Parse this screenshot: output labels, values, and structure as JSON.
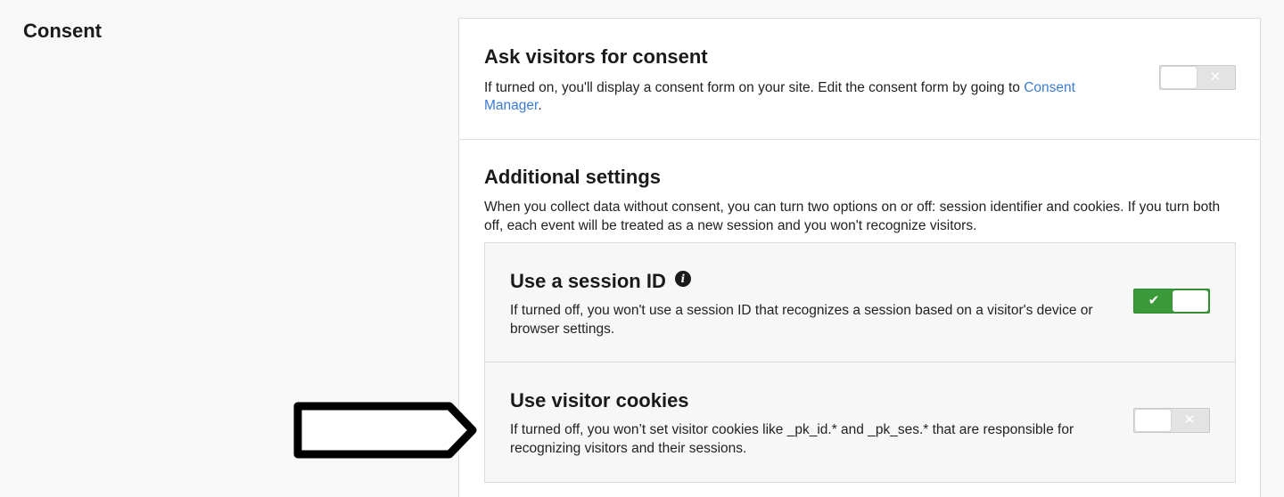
{
  "section": {
    "title": "Consent"
  },
  "ask": {
    "title": "Ask visitors for consent",
    "desc_prefix": "If turned on, you'll display a consent form on your site. Edit the consent form by going to ",
    "link": "Consent Manager",
    "desc_suffix": ".",
    "toggle_mark": "✕",
    "toggle_state": "off"
  },
  "additional": {
    "title": "Additional settings",
    "desc": "When you collect data without consent, you can turn two options on or off: session identifier and cookies. If you turn both off, each event will be treated as a new session and you won't recognize visitors."
  },
  "session": {
    "title": "Use a session ID",
    "info_glyph": "i",
    "desc": "If turned off, you won't use a session ID that recognizes a session based on a visitor's device or browser settings.",
    "toggle_mark": "✔",
    "toggle_state": "on"
  },
  "cookies": {
    "title": "Use visitor cookies",
    "desc": "If turned off, you won’t set visitor cookies like _pk_id.* and _pk_ses.* that are responsible for recognizing visitors and their sessions.",
    "toggle_mark": "✕",
    "toggle_state": "off"
  },
  "colors": {
    "accent_link": "#3a7bd5",
    "toggle_on": "#3a9a3a",
    "toggle_off": "#e3e3e3"
  }
}
